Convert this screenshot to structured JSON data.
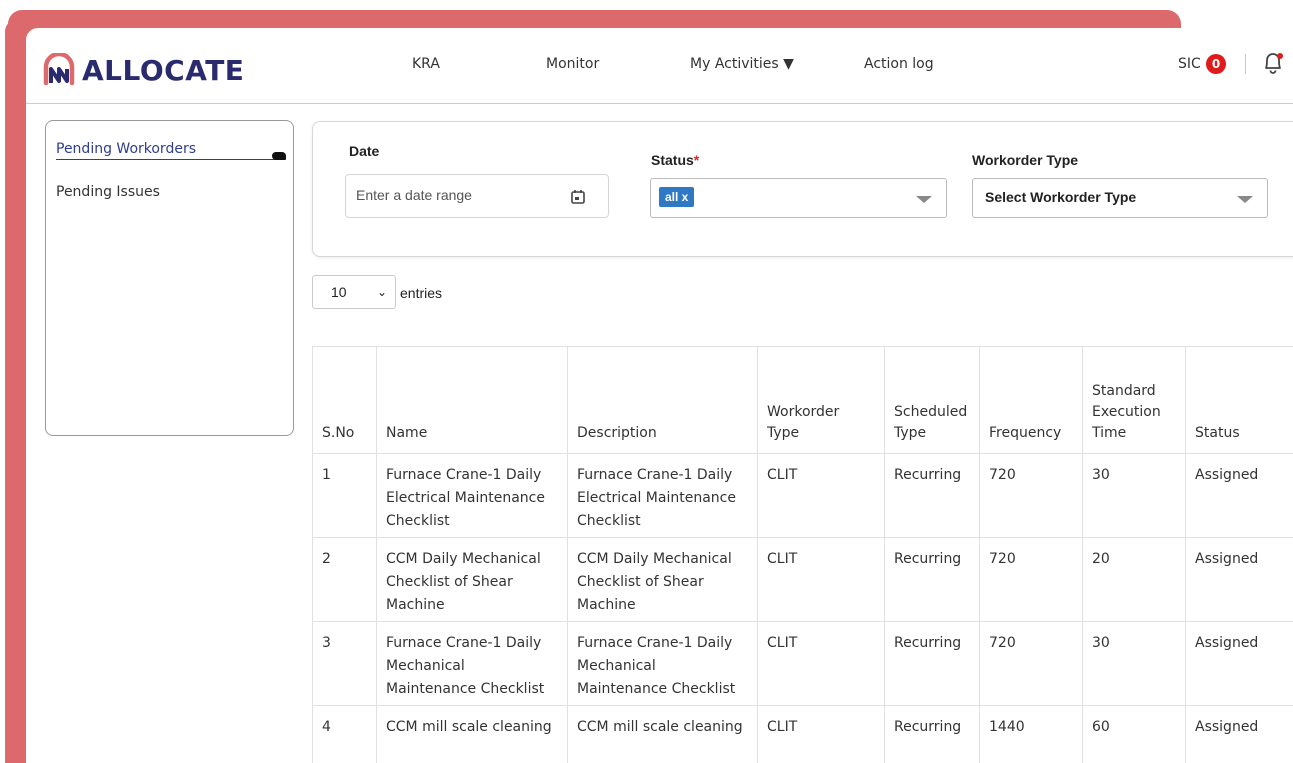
{
  "brand": {
    "name": "ALLOCATE",
    "primary": "#2a2a6e",
    "accent": "#dc6a6c"
  },
  "nav": {
    "kra": "KRA",
    "monitor": "Monitor",
    "my_activities": "My Activities ▼",
    "action_log": "Action log"
  },
  "header_right": {
    "user": "SIC",
    "notification_count": "0",
    "bell_icon": "bell-icon"
  },
  "sidebar": {
    "items": [
      {
        "label": "Pending Workorders",
        "active": true
      },
      {
        "label": "Pending Issues",
        "active": false
      }
    ]
  },
  "filters": {
    "date_label": "Date",
    "date_placeholder": "Enter a date range",
    "status_label": "Status",
    "status_required": "*",
    "status_tag": "all x",
    "type_label": "Workorder Type",
    "type_value": "Select Workorder Type"
  },
  "entries": {
    "value": "10",
    "label": "entries"
  },
  "table": {
    "headers": [
      "S.No",
      "Name",
      "Description",
      "Workorder Type",
      "Scheduled Type",
      "Frequency",
      "Standard Execution Time",
      "Status"
    ],
    "rows": [
      [
        "1",
        "Furnace Crane-1 Daily Electrical Maintenance Checklist",
        "Furnace Crane-1 Daily Electrical Maintenance Checklist",
        "CLIT",
        "Recurring",
        "720",
        "30",
        "Assigned"
      ],
      [
        "2",
        "CCM Daily Mechanical Checklist of Shear Machine",
        "CCM Daily Mechanical Checklist of Shear Machine",
        "CLIT",
        "Recurring",
        "720",
        "20",
        "Assigned"
      ],
      [
        "3",
        "Furnace Crane-1 Daily Mechanical Maintenance Checklist",
        "Furnace Crane-1 Daily Mechanical Maintenance Checklist",
        "CLIT",
        "Recurring",
        "720",
        "30",
        "Assigned"
      ],
      [
        "4",
        "CCM mill scale cleaning",
        "CCM mill scale cleaning",
        "CLIT",
        "Recurring",
        "1440",
        "60",
        "Assigned"
      ]
    ]
  }
}
